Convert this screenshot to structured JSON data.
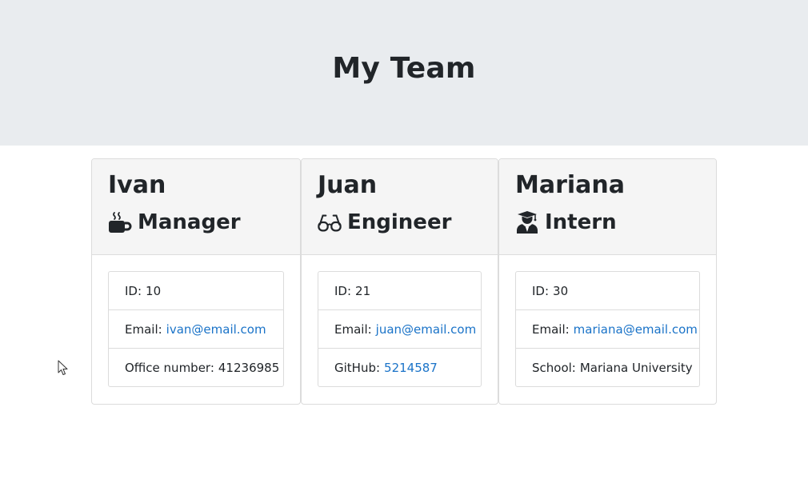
{
  "header": {
    "title": "My Team"
  },
  "team": [
    {
      "name": "Ivan",
      "role": "Manager",
      "role_icon": "mug-icon",
      "id_label": "ID:",
      "id": "10",
      "email_label": "Email:",
      "email": "ivan@email.com",
      "extra_label": "Office number:",
      "extra_value": "41236985"
    },
    {
      "name": "Juan",
      "role": "Engineer",
      "role_icon": "glasses-icon",
      "id_label": "ID:",
      "id": "21",
      "email_label": "Email:",
      "email": "juan@email.com",
      "extra_label": "GitHub:",
      "extra_value": "5214587"
    },
    {
      "name": "Mariana",
      "role": "Intern",
      "role_icon": "graduate-icon",
      "id_label": "ID:",
      "id": "30",
      "email_label": "Email:",
      "email": "mariana@email.com",
      "extra_label": "School:",
      "extra_value": "Mariana University"
    }
  ],
  "colors": {
    "header_bg": "#e9ecef",
    "card_header_bg": "#f5f5f5",
    "link": "#1a73c8",
    "text": "#212529"
  }
}
